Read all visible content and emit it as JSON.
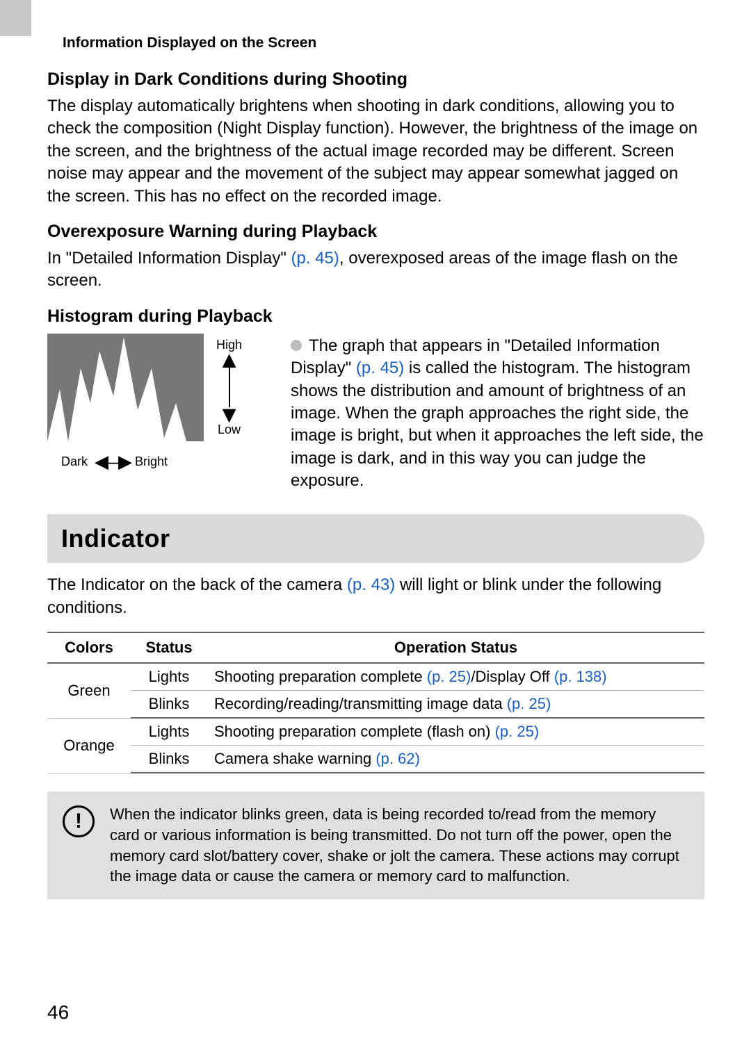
{
  "header": {
    "running_title": "Information Displayed on the Screen"
  },
  "sections": {
    "dark": {
      "heading": "Display in Dark Conditions during Shooting",
      "body": "The display automatically brightens when shooting in dark conditions, allowing you to check the composition (Night Display function). However, the brightness of the image on the screen, and the brightness of the actual image recorded may be different. Screen noise may appear and the movement of the subject may appear somewhat jagged on the screen. This has no effect on the recorded image."
    },
    "overexposure": {
      "heading": "Overexposure Warning during Playback",
      "body_prefix": "In \"Detailed Information Display\" ",
      "link": "(p. 45)",
      "body_suffix": ", overexposed areas of the image flash on the screen."
    },
    "histogram": {
      "heading": "Histogram during Playback",
      "figure": {
        "high": "High",
        "low": "Low",
        "dark": "Dark",
        "bright": "Bright"
      },
      "desc_prefix": "The graph that appears in \"Detailed Information Display\" ",
      "desc_link": "(p. 45)",
      "desc_suffix": " is called the histogram. The histogram shows the distribution and amount of brightness of an image. When the graph approaches the right side, the image is bright, but when it approaches the left side, the image is dark, and in this way you can judge the exposure."
    }
  },
  "indicator": {
    "title": "Indicator",
    "intro_prefix": "The Indicator on the back of the camera ",
    "intro_link": "(p. 43)",
    "intro_suffix": " will light or blink under the following conditions.",
    "table": {
      "headers": {
        "colors": "Colors",
        "status": "Status",
        "operation": "Operation Status"
      },
      "rows": [
        {
          "color": "Green",
          "status": "Lights",
          "op_parts": [
            "Shooting preparation complete ",
            "(p. 25)",
            "/Display Off ",
            "(p. 138)"
          ]
        },
        {
          "color": "",
          "status": "Blinks",
          "op_parts": [
            "Recording/reading/transmitting image data ",
            "(p. 25)"
          ]
        },
        {
          "color": "Orange",
          "status": "Lights",
          "op_parts": [
            "Shooting preparation complete (flash on) ",
            "(p. 25)"
          ]
        },
        {
          "color": "",
          "status": "Blinks",
          "op_parts": [
            "Camera shake warning ",
            "(p. 62)"
          ]
        }
      ]
    },
    "caution": "When the indicator blinks green, data is being recorded to/read from the memory card or various information is being transmitted. Do not turn off the power, open the memory card slot/battery cover, shake or jolt the camera. These actions may corrupt the image data or cause the camera or memory card to malfunction."
  },
  "page_number": "46"
}
